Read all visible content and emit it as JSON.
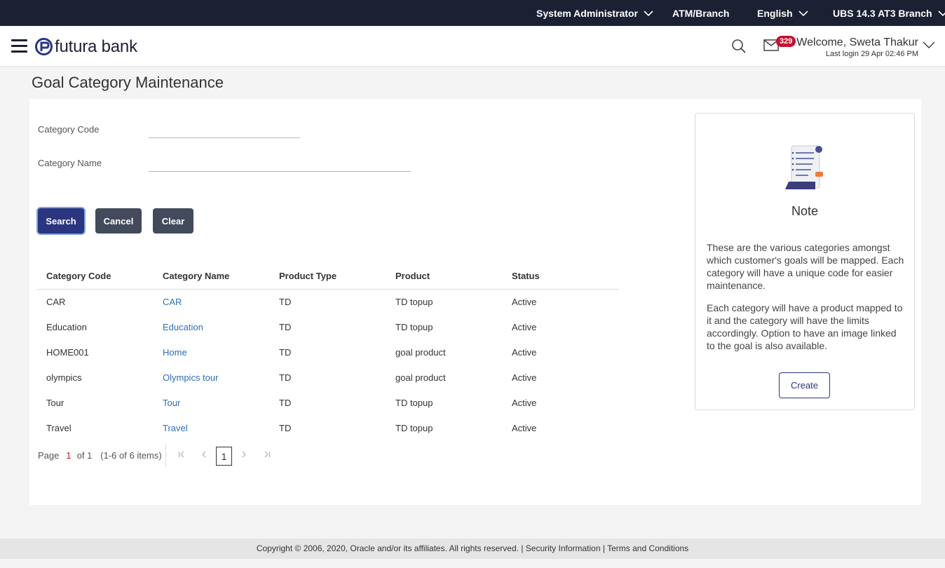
{
  "topbar": {
    "role": "System Administrator",
    "branch": "ATM/Branch",
    "language": "English",
    "entity": "UBS 14.3 AT3 Branch"
  },
  "header": {
    "brand": "futura bank",
    "notification_count": "329",
    "welcome": "Welcome, Sweta Thakur",
    "last_login": "Last login 29 Apr 02:46 PM"
  },
  "page": {
    "title": "Goal Category Maintenance"
  },
  "form": {
    "category_code_label": "Category Code",
    "category_code_value": "",
    "category_name_label": "Category Name",
    "category_name_value": ""
  },
  "buttons": {
    "search": "Search",
    "cancel": "Cancel",
    "clear": "Clear"
  },
  "table": {
    "headers": [
      "Category Code",
      "Category Name",
      "Product Type",
      "Product",
      "Status"
    ],
    "rows": [
      {
        "code": "CAR",
        "name": "CAR",
        "product_type": "TD",
        "product": "TD topup",
        "status": "Active"
      },
      {
        "code": "Education",
        "name": "Education",
        "product_type": "TD",
        "product": "TD topup",
        "status": "Active"
      },
      {
        "code": "HOME001",
        "name": "Home",
        "product_type": "TD",
        "product": "goal product",
        "status": "Active"
      },
      {
        "code": "olympics",
        "name": "Olympics tour",
        "product_type": "TD",
        "product": "goal product",
        "status": "Active"
      },
      {
        "code": "Tour",
        "name": "Tour",
        "product_type": "TD",
        "product": "TD topup",
        "status": "Active"
      },
      {
        "code": "Travel",
        "name": "Travel",
        "product_type": "TD",
        "product": "TD topup",
        "status": "Active"
      }
    ]
  },
  "pager": {
    "page_label": "Page",
    "current": "1",
    "of_label": "of 1",
    "items": "(1-6 of 6 items)",
    "page_box": "1"
  },
  "note": {
    "title": "Note",
    "paragraph1": "These are the various categories amongst which customer's goals will be mapped. Each category will have a unique code for easier maintenance.",
    "paragraph2": "Each category will have a product mapped to it and the category will have the limits accordingly. Option to have an image linked to the goal is also available.",
    "create_label": "Create"
  },
  "footer": {
    "copyright": "Copyright © 2006, 2020, Oracle and/or its affiliates. All rights reserved.",
    "separator": "|",
    "security": "Security Information",
    "terms": "Terms and Conditions"
  },
  "colors": {
    "topbar": "#1c2033",
    "primary": "#2b3580",
    "link": "#2f6db5",
    "badge": "#c8102e"
  }
}
